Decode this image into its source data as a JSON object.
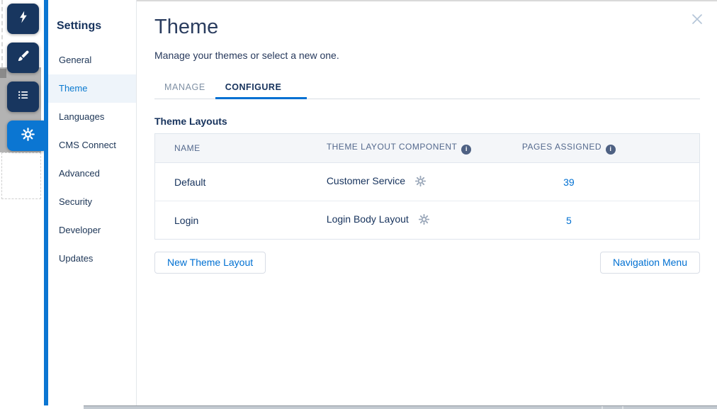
{
  "toolbar": {
    "icons": [
      {
        "name": "lightning",
        "active": false
      },
      {
        "name": "brush",
        "active": false
      },
      {
        "name": "list",
        "active": false
      },
      {
        "name": "gear",
        "active": true
      }
    ]
  },
  "sidebar": {
    "title": "Settings",
    "items": [
      {
        "label": "General",
        "selected": false
      },
      {
        "label": "Theme",
        "selected": true
      },
      {
        "label": "Languages",
        "selected": false
      },
      {
        "label": "CMS Connect",
        "selected": false
      },
      {
        "label": "Advanced",
        "selected": false
      },
      {
        "label": "Security",
        "selected": false
      },
      {
        "label": "Developer",
        "selected": false
      },
      {
        "label": "Updates",
        "selected": false
      }
    ]
  },
  "main": {
    "title": "Theme",
    "subtitle": "Manage your themes or select a new one.",
    "tabs": [
      {
        "label": "MANAGE",
        "active": false
      },
      {
        "label": "CONFIGURE",
        "active": true
      }
    ],
    "section_title": "Theme Layouts",
    "table": {
      "columns": [
        {
          "label": "NAME",
          "info_icon": false
        },
        {
          "label": "THEME LAYOUT COMPONENT",
          "info_icon": true
        },
        {
          "label": "PAGES ASSIGNED",
          "info_icon": true
        }
      ],
      "rows": [
        {
          "name": "Default",
          "component": "Customer Service",
          "pages_assigned": "39"
        },
        {
          "name": "Login",
          "component": "Login Body Layout",
          "pages_assigned": "5"
        }
      ]
    },
    "buttons": {
      "new_theme_layout": "New Theme Layout",
      "navigation_menu": "Navigation Menu"
    }
  },
  "icons": {
    "info_glyph": "i"
  },
  "colors": {
    "accent_blue": "#0b76d2",
    "link_blue": "#0070d2",
    "dark_navy": "#16325c",
    "selected_item_bg": "#eef4fa",
    "table_header_bg": "#f4f6f9"
  }
}
